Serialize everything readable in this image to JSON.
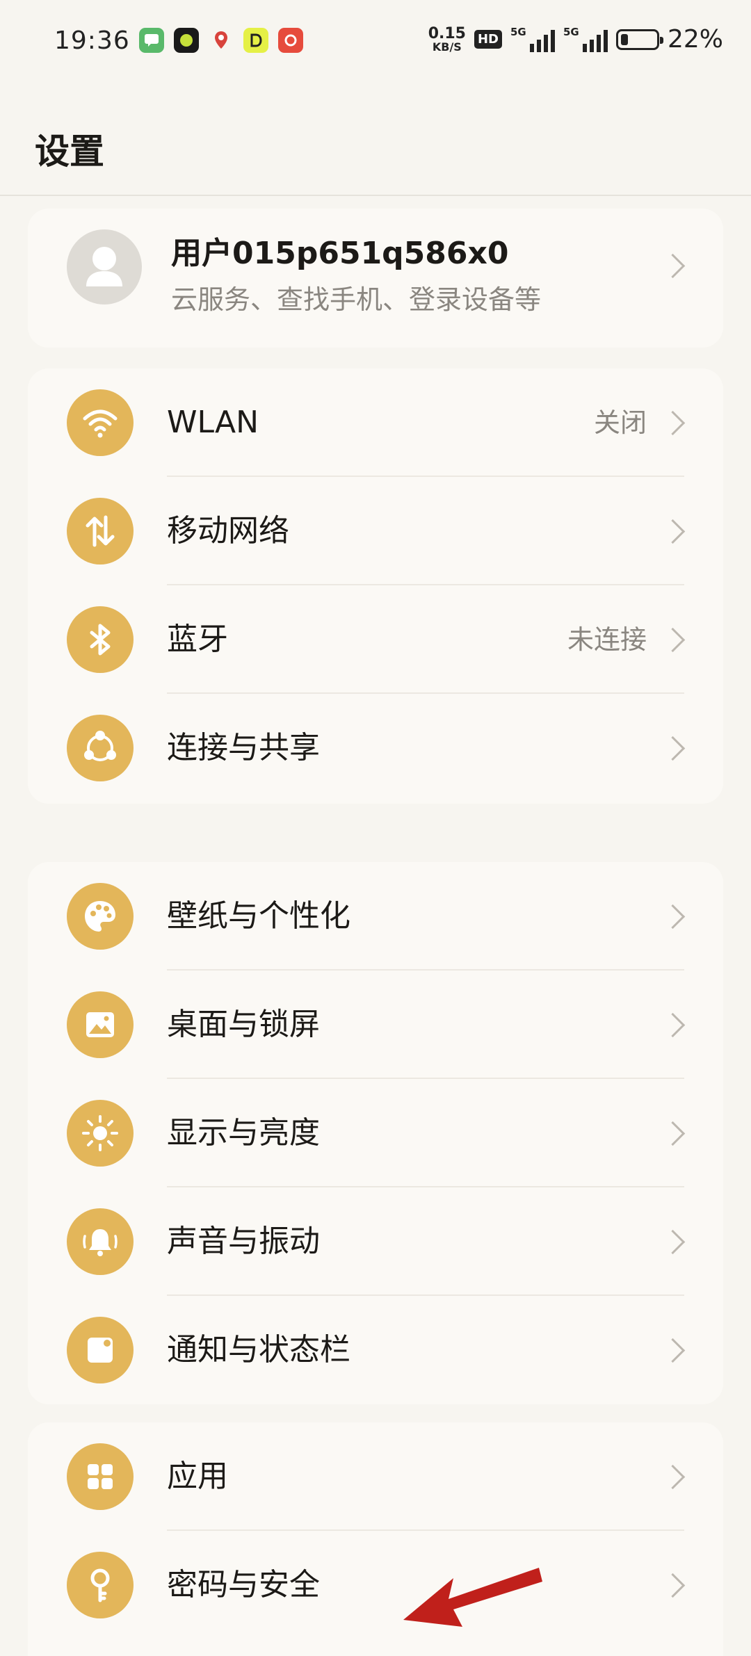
{
  "status_bar": {
    "time": "19:36",
    "net_speed_value": "0.15",
    "net_speed_unit": "KB/S",
    "hd_label": "HD",
    "signal1_label": "5G",
    "signal2_label": "5G",
    "battery_percent": "22%"
  },
  "header": {
    "title": "设置"
  },
  "account": {
    "name": "用户015p651q586x0",
    "subtitle": "云服务、查找手机、登录设备等"
  },
  "group1": [
    {
      "label": "WLAN",
      "value": "关闭",
      "icon": "wifi-icon"
    },
    {
      "label": "移动网络",
      "value": "",
      "icon": "mobile-data-icon"
    },
    {
      "label": "蓝牙",
      "value": "未连接",
      "icon": "bluetooth-icon"
    },
    {
      "label": "连接与共享",
      "value": "",
      "icon": "share-icon"
    }
  ],
  "group2": [
    {
      "label": "壁纸与个性化",
      "icon": "palette-icon"
    },
    {
      "label": "桌面与锁屏",
      "icon": "image-icon"
    },
    {
      "label": "显示与亮度",
      "icon": "sun-icon"
    },
    {
      "label": "声音与振动",
      "icon": "bell-icon"
    },
    {
      "label": "通知与状态栏",
      "icon": "notification-icon"
    }
  ],
  "group3": [
    {
      "label": "应用",
      "icon": "apps-grid-icon"
    },
    {
      "label": "密码与安全",
      "icon": "key-icon"
    }
  ],
  "colors": {
    "accent": "#e3b65a",
    "background": "#f7f5f0",
    "secondary_text": "#8a8680",
    "annotation_arrow": "#c0201b"
  }
}
